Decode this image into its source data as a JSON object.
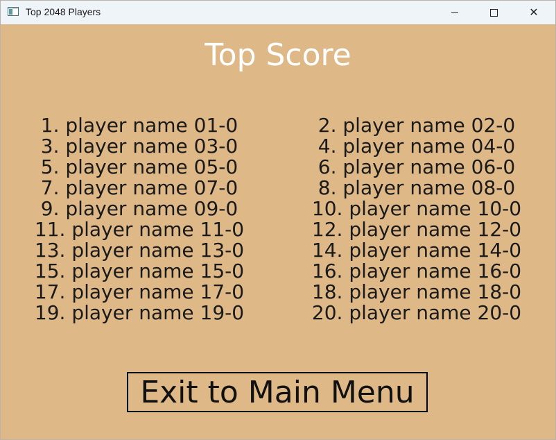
{
  "window": {
    "title": "Top 2048 Players",
    "app_icon": "window-app-icon",
    "controls": {
      "minimize_icon": "minimize-icon",
      "maximize_icon": "maximize-icon",
      "close_icon": "close-icon",
      "close_glyph": "✕"
    }
  },
  "page": {
    "heading": "Top Score",
    "exit_label": "Exit to Main Menu"
  },
  "colors": {
    "background": "#deb887",
    "heading": "#ffffff",
    "text": "#1a1a1a",
    "titlebar": "#eff4f9"
  },
  "leaderboard": {
    "left": [
      "1. player name 01-0",
      "3. player name 03-0",
      "5. player name 05-0",
      "7. player name 07-0",
      "9. player name 09-0",
      "11. player name 11-0",
      "13. player name 13-0",
      "15. player name 15-0",
      "17. player name 17-0",
      "19. player name 19-0"
    ],
    "right": [
      "2. player name 02-0",
      "4. player name 04-0",
      "6. player name 06-0",
      "8. player name 08-0",
      "10. player name 10-0",
      "12. player name 12-0",
      "14. player name 14-0",
      "16. player name 16-0",
      "18. player name 18-0",
      "20. player name 20-0"
    ]
  }
}
